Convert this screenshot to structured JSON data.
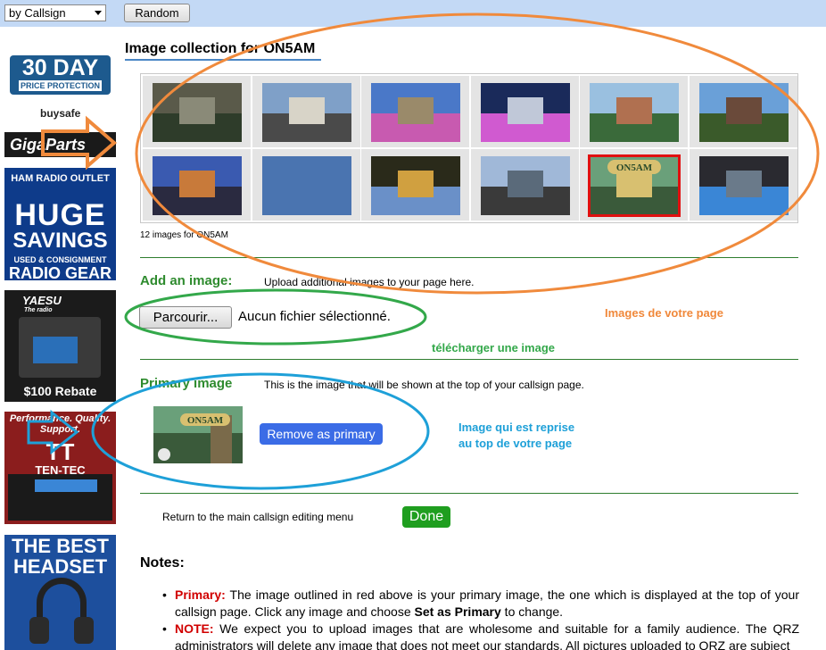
{
  "toolbar": {
    "search_select_value": "by Callsign",
    "random_button": "Random"
  },
  "sidebar_ads": [
    {
      "name": "gigaparts-ad",
      "line1": "30 DAY",
      "line2": "PRICE PROTECTION",
      "line3": "buysafe",
      "brand": "GigaParts"
    },
    {
      "name": "hamradio-outlet-ad",
      "line1": "HAM RADIO OUTLET",
      "line2": "HUGE",
      "line3": "SAVINGS",
      "line4": "USED & CONSIGNMENT",
      "line5": "RADIO GEAR"
    },
    {
      "name": "yaesu-ad",
      "brand": "YAESU",
      "tagline": "The radio",
      "rebate": "$100 Rebate"
    },
    {
      "name": "tentec-ad",
      "line1": "Performance. Quality. Support.",
      "brand": "TEN-TEC"
    },
    {
      "name": "headset-ad",
      "line1": "THE BEST",
      "line2": "HEADSET"
    }
  ],
  "gallery": {
    "title": "Image collection for ON5AM",
    "count_text": "12 images for ON5AM",
    "images": [
      {
        "caption": "",
        "colors": [
          "#5a5a4a",
          "#8a8a78",
          "#2e3c2a"
        ]
      },
      {
        "caption": "",
        "colors": [
          "#7fa0c8",
          "#d8d4c8",
          "#4a4a4a"
        ]
      },
      {
        "caption": "",
        "colors": [
          "#4a78c8",
          "#9a8a6a",
          "#c85ab0"
        ]
      },
      {
        "caption": "",
        "colors": [
          "#1a2a5a",
          "#c0c8d8",
          "#d05ad0"
        ]
      },
      {
        "caption": "",
        "colors": [
          "#9ac0e0",
          "#b07050",
          "#3a6a3a"
        ]
      },
      {
        "caption": "",
        "colors": [
          "#6aa0d8",
          "#6a4a3a",
          "#3a5a2a"
        ]
      },
      {
        "caption": "",
        "colors": [
          "#3a5ab0",
          "#c87a3a",
          "#2a2a40"
        ]
      },
      {
        "caption": "",
        "colors": [
          "#4a74b0",
          "#4a74b0",
          "#4a74b0"
        ]
      },
      {
        "caption": "",
        "colors": [
          "#2a2a1a",
          "#d0a040",
          "#6a90c8"
        ]
      },
      {
        "caption": "",
        "colors": [
          "#a0b8d8",
          "#5a6a7a",
          "#3a3a3a"
        ]
      },
      {
        "caption": "ON5AM",
        "colors": [
          "#6aa07a",
          "#d8c070",
          "#3a5a3a"
        ],
        "primary": true
      },
      {
        "caption": "",
        "colors": [
          "#2a2a30",
          "#6a7a8a",
          "#3a86d6"
        ]
      }
    ]
  },
  "add_image": {
    "heading": "Add an image:",
    "description": "Upload additional images to your page here.",
    "browse_button": "Parcourir...",
    "no_file_text": "Aucun fichier sélectionné."
  },
  "annotations": {
    "images_page": "Images de votre page",
    "upload": "télécharger une image",
    "top_line1": "Image qui est reprise",
    "top_line2": "au top de votre page"
  },
  "primary_image": {
    "heading": "Primary image",
    "description": "This is the image that will be shown at the top of your callsign page.",
    "thumb_caption": "ON5AM",
    "remove_button": "Remove as primary"
  },
  "footer": {
    "return_text": "Return to the main callsign editing menu",
    "done_button": "Done"
  },
  "notes": {
    "heading": "Notes:",
    "items": [
      {
        "lead": "Primary:",
        "text": " The image outlined in red above is your primary image, the one which is displayed at the top of your callsign page. Click any image and choose ",
        "bold": "Set as Primary",
        "tail": " to change."
      },
      {
        "lead": "NOTE:",
        "text": " We expect you to upload images that are wholesome and suitable for a family audience. The QRZ administrators will delete any image that does not meet our standards. All pictures uploaded to QRZ are subject",
        "bold": "",
        "tail": ""
      }
    ]
  },
  "colors": {
    "topbar": "#c3d9f5",
    "section_green": "#2e8b2e",
    "primary_outline": "#e01010",
    "remove_button": "#3b6ce6",
    "done_button": "#1f9e1f",
    "anno_orange": "#f0883a",
    "anno_green": "#33a84a",
    "anno_blue": "#1ea0d8"
  }
}
